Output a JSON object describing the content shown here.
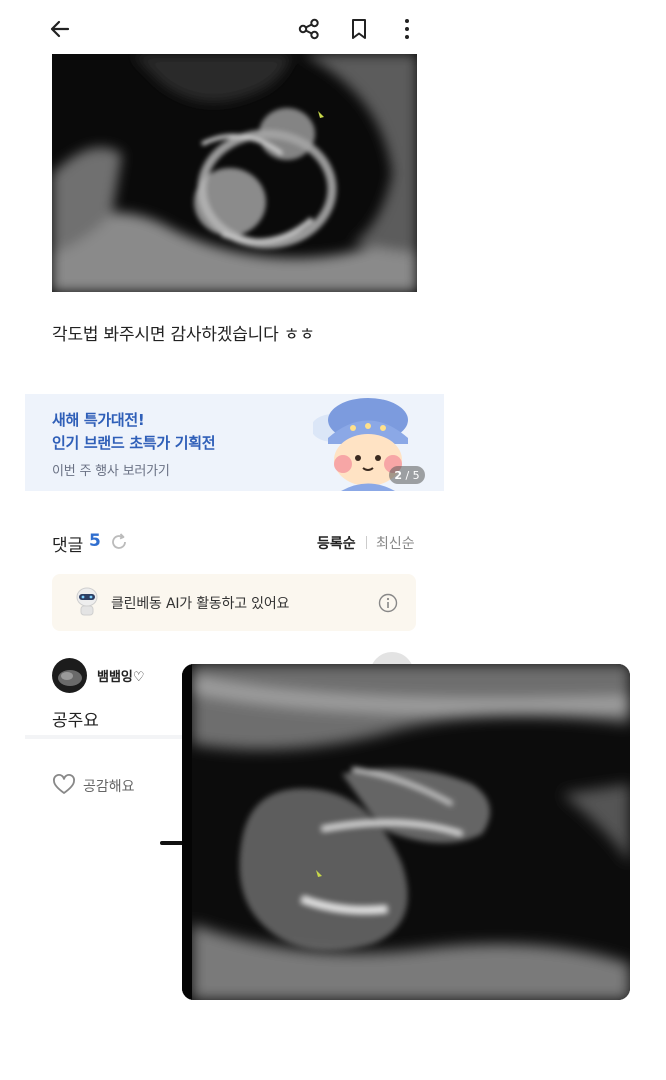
{
  "header": {
    "back_icon": "arrow-left-icon",
    "share_icon": "share-icon",
    "bookmark_icon": "bookmark-icon",
    "more_icon": "more-vertical-icon"
  },
  "post": {
    "image": "ultrasound-image",
    "text": "각도법 봐주시면 감사하겠습니다 ㅎㅎ"
  },
  "banner": {
    "line1": "새해 특가대전!",
    "line2": "인기 브랜드 초특가 기획전",
    "line3": "이번 주 행사 보러가기",
    "page_current": "2",
    "page_total": "/ 5",
    "mascot_icon": "mascot-icon"
  },
  "comments": {
    "title": "댓글",
    "count": "5",
    "refresh_icon": "refresh-icon",
    "sort_registered": "등록순",
    "sort_latest": "최신순"
  },
  "ai_notice": {
    "text": "클린베동 AI가 활동하고 있어요",
    "info_icon": "info-icon",
    "robot_icon": "robot-icon"
  },
  "comment": {
    "username": "뱀뱀잉♡",
    "text": "공주요",
    "like_label": "공감해요",
    "like_icon": "heart-outline-icon"
  },
  "colors": {
    "accent_blue": "#2f6ecf",
    "banner_bg": "#eef3fb",
    "banner_text": "#2f5fb8",
    "ai_box_bg": "#fbf7ef"
  }
}
